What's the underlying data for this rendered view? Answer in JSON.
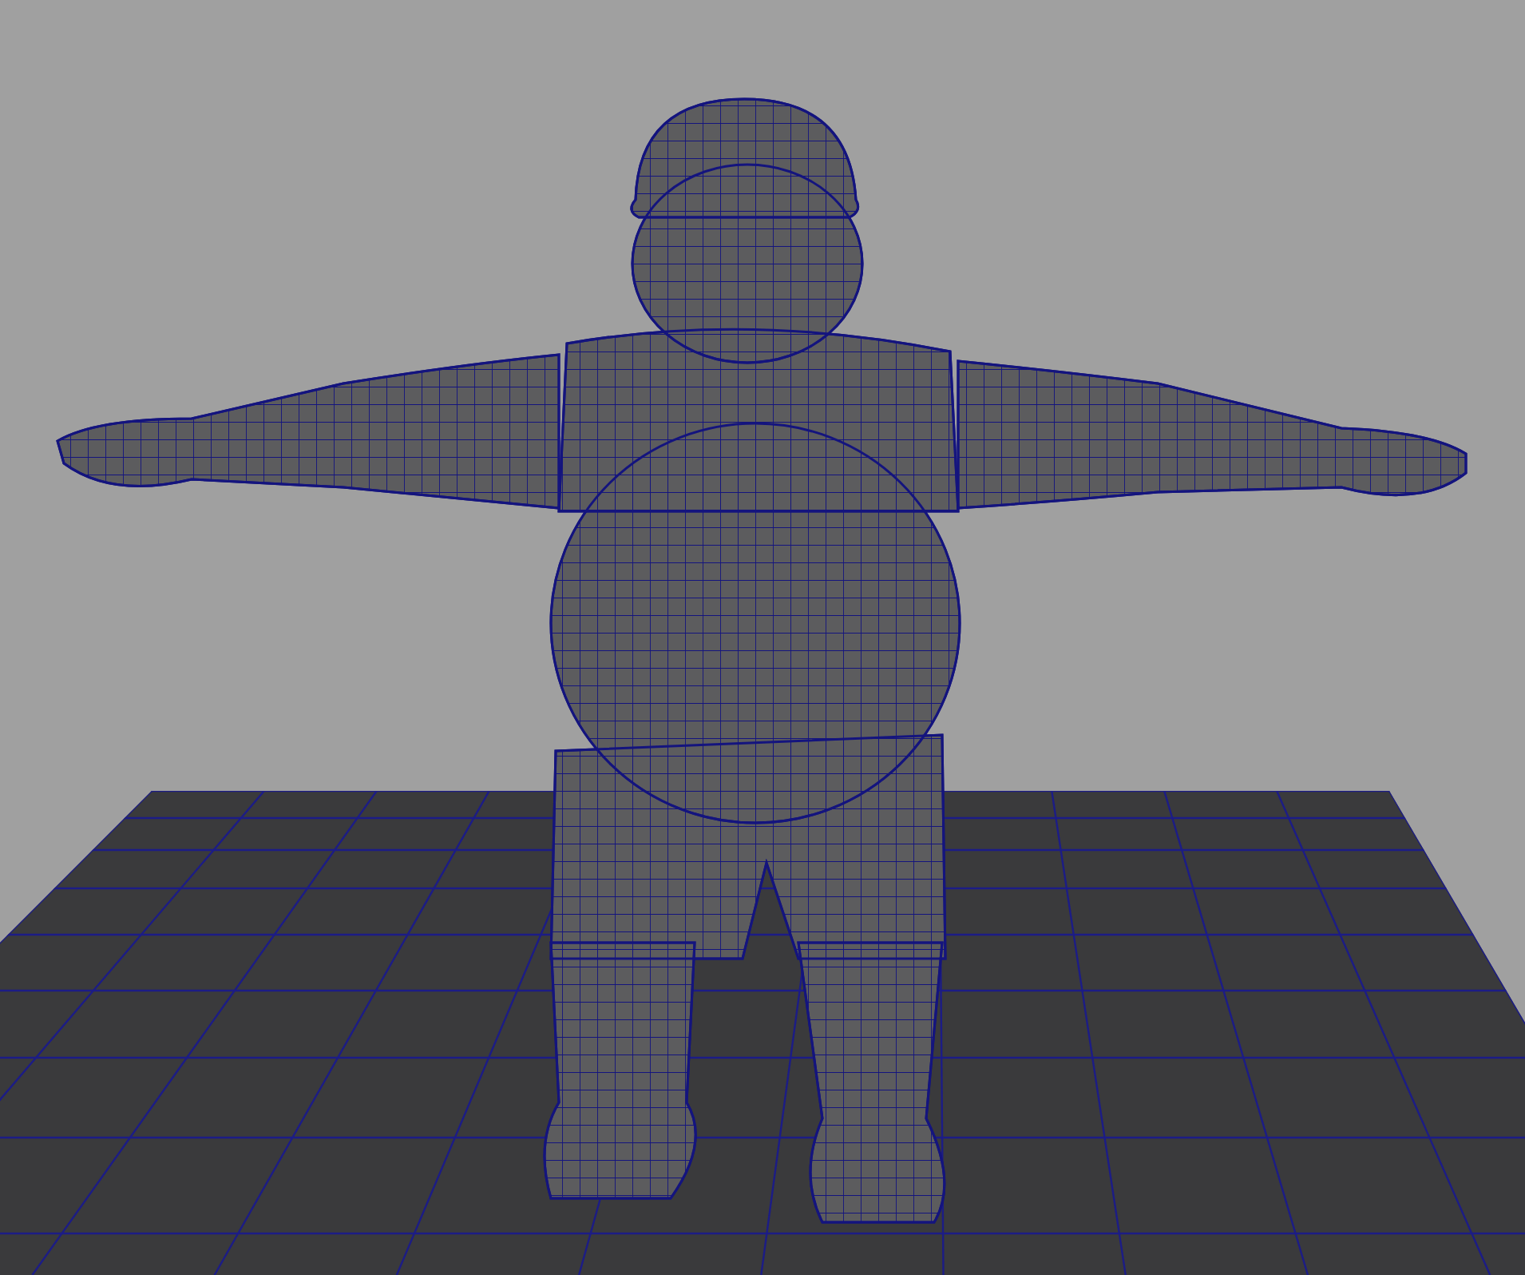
{
  "viewport": {
    "show_grid": true,
    "wireframe_on_shaded": true
  }
}
